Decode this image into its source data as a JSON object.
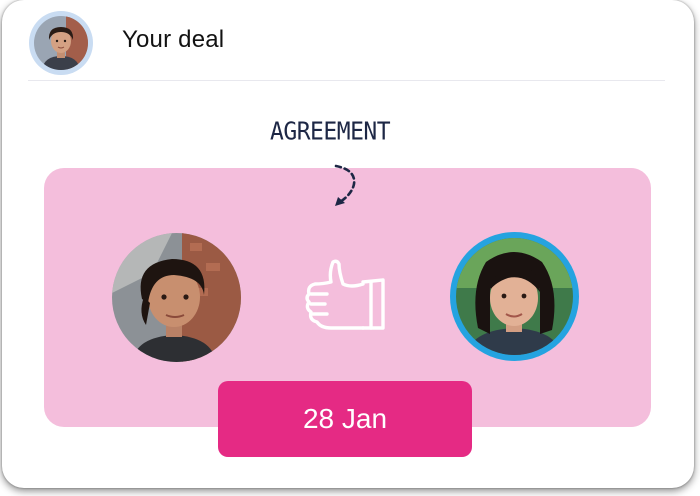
{
  "header": {
    "title": "Your deal",
    "avatar_icon": "user-avatar"
  },
  "annotation": {
    "label": "AGREEMENT",
    "arrow_icon": "curved-arrow-down-icon"
  },
  "deal": {
    "left_party_icon": "party-avatar",
    "right_party_icon": "party-avatar",
    "handshake_icon": "thumbs-up-icon",
    "date": "28 Jan"
  },
  "colors": {
    "panel": "#f4bedc",
    "accent": "#e52a84",
    "ring": "#25a3e0",
    "header_avatar_bg": "#c9dcf2",
    "ink": "#1d2745"
  }
}
